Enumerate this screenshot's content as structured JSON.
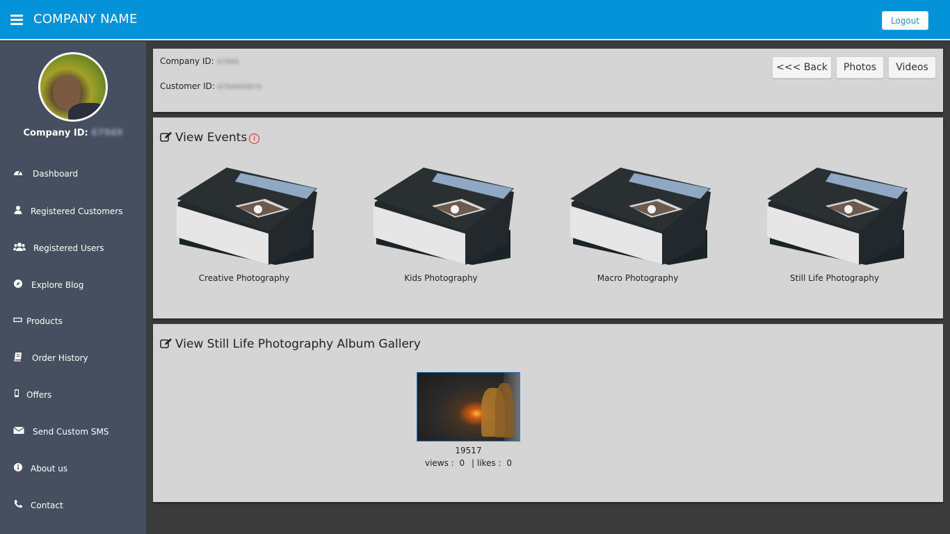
{
  "header": {
    "brand": "COMPANY NAME",
    "logout_label": "Logout"
  },
  "sidebar": {
    "company_label": "Company ID:",
    "company_value": "67949",
    "items": [
      {
        "label": "Dashboard",
        "icon": "dashboard-icon"
      },
      {
        "label": "Registered Customers",
        "icon": "user-icon"
      },
      {
        "label": "Registered Users",
        "icon": "users-icon"
      },
      {
        "label": "Explore Blog",
        "icon": "compass-icon"
      },
      {
        "label": "Products",
        "icon": "rectangle-icon"
      },
      {
        "label": "Order History",
        "icon": "book-icon"
      },
      {
        "label": "Offers",
        "icon": "mobile-icon"
      },
      {
        "label": "Send Custom SMS",
        "icon": "envelope-icon"
      },
      {
        "label": "About us",
        "icon": "info-icon"
      },
      {
        "label": "Contact",
        "icon": "phone-icon"
      }
    ]
  },
  "info": {
    "company_label": "Company ID:",
    "company_value": "67949",
    "customer_label": "Customer ID:",
    "customer_value": "6794950874",
    "back_label": "<<< Back",
    "photos_label": "Photos",
    "videos_label": "Videos"
  },
  "events": {
    "title": "View Events",
    "items": [
      {
        "label": "Creative Photography"
      },
      {
        "label": "Kids Photography"
      },
      {
        "label": "Macro Photography"
      },
      {
        "label": "Still Life Photography"
      }
    ]
  },
  "gallery": {
    "title": "View Still Life Photography Album Gallery",
    "photo": {
      "id": "19517",
      "views_label": "views :",
      "views": "0",
      "likes_label": "| likes :",
      "likes": "0"
    }
  },
  "colors": {
    "topbar": "#0492d9",
    "sidebar": "#454f60",
    "accent": "#2f7fcf",
    "info_icon": "#dd2222"
  }
}
